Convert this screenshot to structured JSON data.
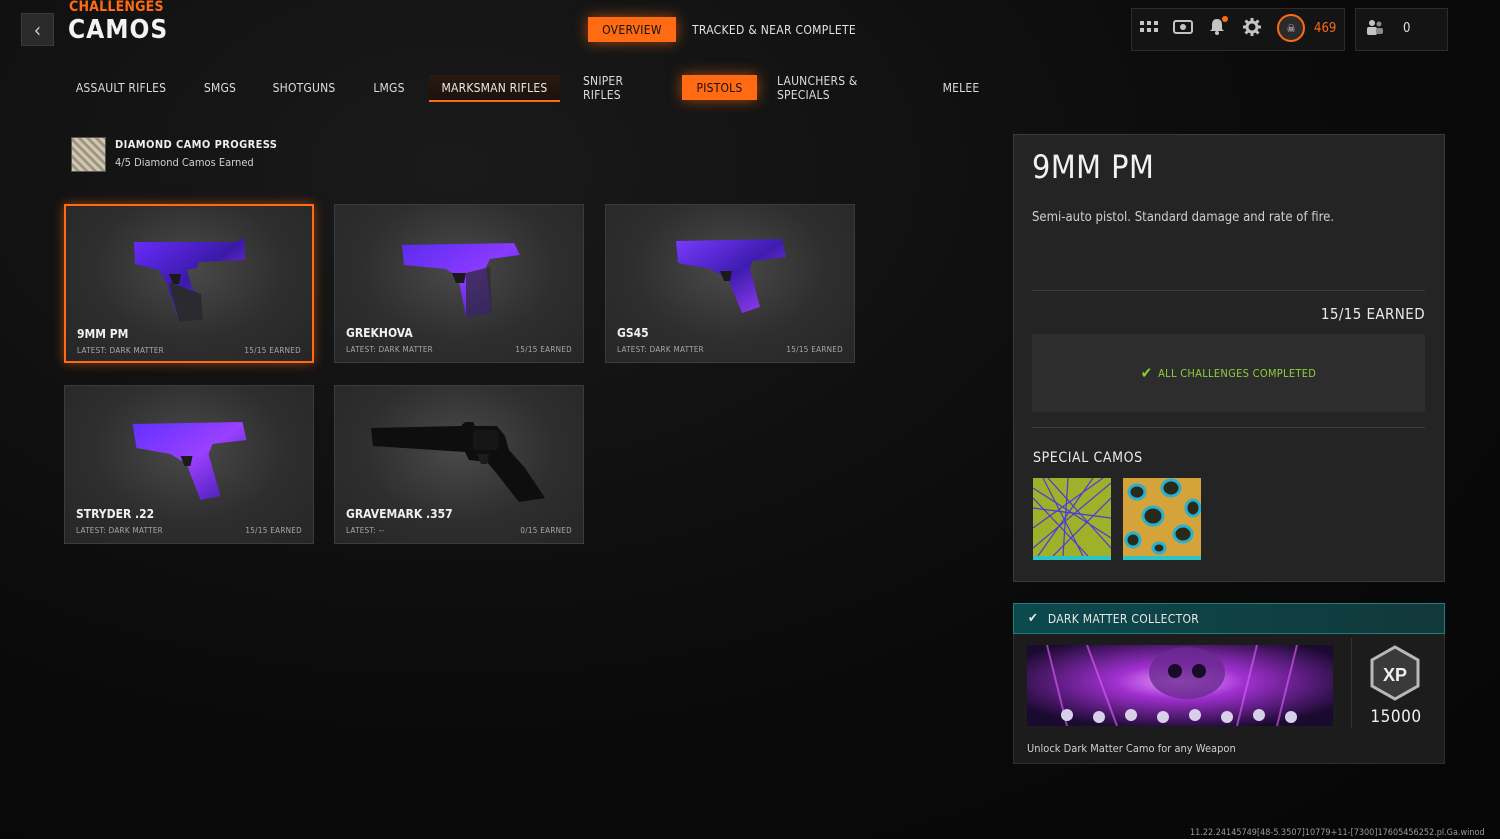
{
  "header": {
    "breadcrumb": "CHALLENGES",
    "title": "CAMOS",
    "tabs": [
      {
        "label": "OVERVIEW",
        "active": true
      },
      {
        "label": "TRACKED & NEAR COMPLETE",
        "active": false
      }
    ],
    "level": "469",
    "friends_count": "0",
    "accent_color": "#ff6a13"
  },
  "categories": [
    {
      "label": "ASSAULT RIFLES"
    },
    {
      "label": "SMGS"
    },
    {
      "label": "SHOTGUNS"
    },
    {
      "label": "LMGS"
    },
    {
      "label": "MARKSMAN RIFLES"
    },
    {
      "label": "SNIPER RIFLES"
    },
    {
      "label": "PISTOLS",
      "selected": true
    },
    {
      "label": "LAUNCHERS & SPECIALS"
    },
    {
      "label": "MELEE"
    }
  ],
  "progress": {
    "title": "DIAMOND CAMO PROGRESS",
    "subtitle": "4/5 Diamond Camos Earned"
  },
  "weapons": [
    {
      "name": "9MM PM",
      "latest": "LATEST: DARK MATTER",
      "earned": "15/15 EARNED",
      "selected": true
    },
    {
      "name": "GREKHOVA",
      "latest": "LATEST: DARK MATTER",
      "earned": "15/15 EARNED"
    },
    {
      "name": "GS45",
      "latest": "LATEST: DARK MATTER",
      "earned": "15/15 EARNED"
    },
    {
      "name": "STRYDER .22",
      "latest": "LATEST: DARK MATTER",
      "earned": "15/15 EARNED"
    },
    {
      "name": "GRAVEMARK .357",
      "latest": "LATEST: --",
      "earned": "0/15 EARNED"
    }
  ],
  "detail": {
    "name": "9MM PM",
    "description": "Semi-auto pistol.  Standard damage and rate of fire.",
    "earned": "15/15 EARNED",
    "status": "ALL CHALLENGES COMPLETED",
    "special_title": "SPECIAL CAMOS"
  },
  "collector": {
    "title": "DARK MATTER COLLECTOR",
    "description": "Unlock Dark Matter Camo for any Weapon",
    "xp_label": "XP",
    "xp_value": "15000"
  },
  "version": "11.22.24145749[48-5.3507]10779+11-[7300]17605456252.pl.Ga.winod"
}
